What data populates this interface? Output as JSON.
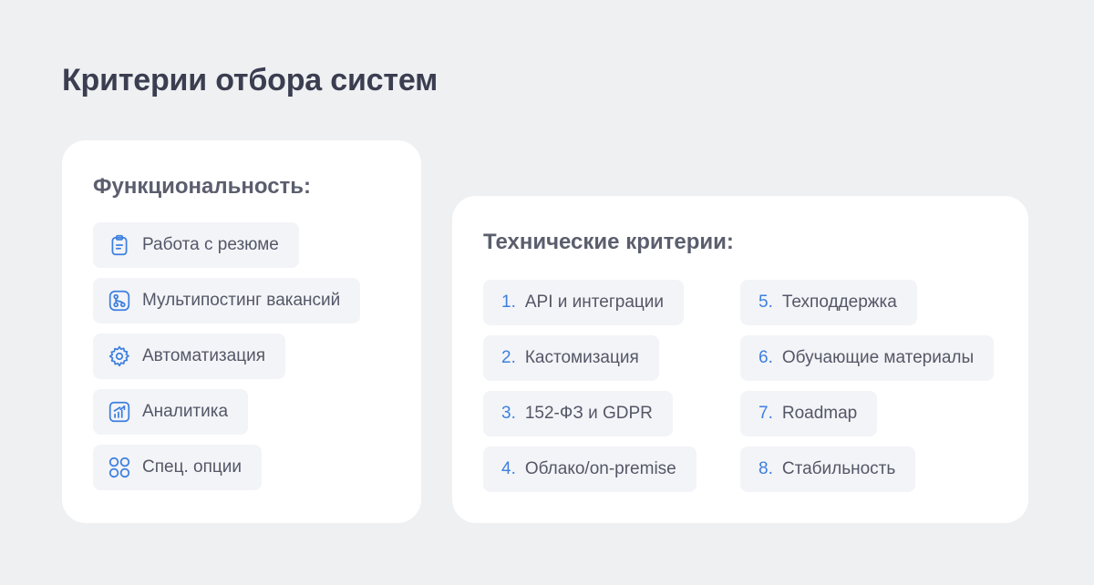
{
  "page": {
    "title": "Критерии отбора систем"
  },
  "functional": {
    "title": "Функциональность:",
    "items": [
      {
        "label": "Работа с резюме",
        "icon": "clipboard-icon"
      },
      {
        "label": "Мультипостинг вакансий",
        "icon": "branch-icon"
      },
      {
        "label": "Автоматизация",
        "icon": "gear-icon"
      },
      {
        "label": "Аналитика",
        "icon": "chart-icon"
      },
      {
        "label": "Спец. опции",
        "icon": "grid-icon"
      }
    ]
  },
  "technical": {
    "title": "Технические критерии:",
    "items": [
      {
        "num": "1.",
        "label": "API и интеграции"
      },
      {
        "num": "2.",
        "label": "Кастомизация"
      },
      {
        "num": "3.",
        "label": "152-ФЗ и GDPR"
      },
      {
        "num": "4.",
        "label": "Облако/on-premise"
      },
      {
        "num": "5.",
        "label": "Техподдержка"
      },
      {
        "num": "6.",
        "label": "Обучающие материалы"
      },
      {
        "num": "7.",
        "label": "Roadmap"
      },
      {
        "num": "8.",
        "label": "Стабильность"
      }
    ]
  },
  "colors": {
    "background": "#eff0f2",
    "card": "#ffffff",
    "chip": "#f3f4f7",
    "accent": "#3d7fe0",
    "title": "#3b3e50",
    "text": "#545767"
  }
}
